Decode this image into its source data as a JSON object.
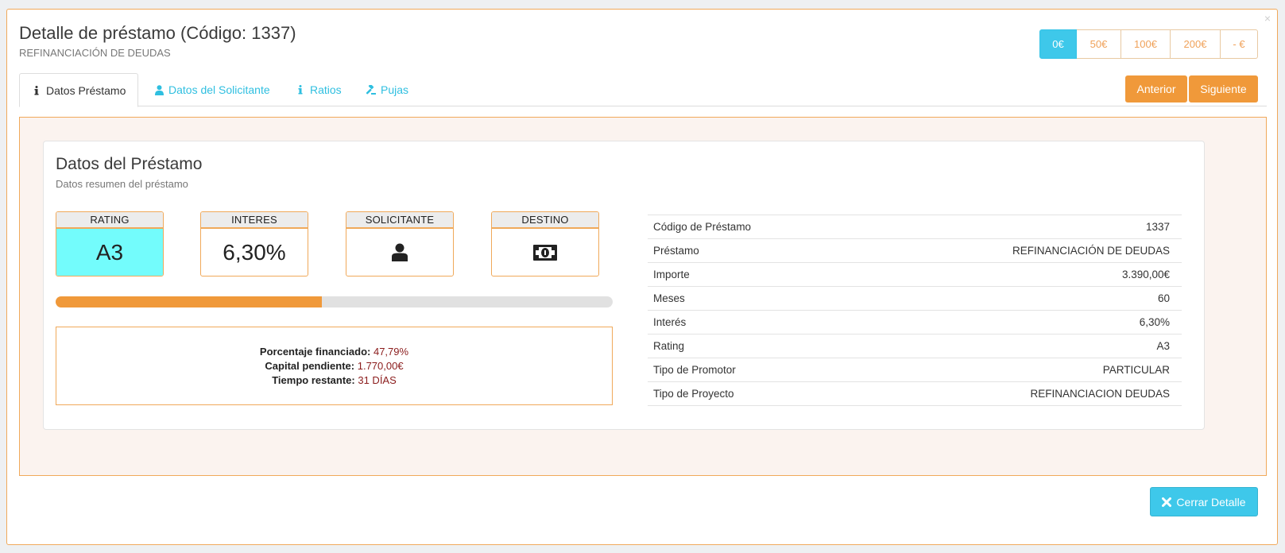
{
  "modal": {
    "title": "Detalle de préstamo (Código: 1337)",
    "subtitle": "REFINANCIACIÓN DE DEUDAS",
    "close_glyph": "×"
  },
  "amount_buttons": [
    {
      "label": "0€",
      "active": true
    },
    {
      "label": "50€",
      "active": false
    },
    {
      "label": "100€",
      "active": false
    },
    {
      "label": "200€",
      "active": false
    },
    {
      "label": "- €",
      "active": false
    }
  ],
  "tabs": [
    {
      "label": "Datos Préstamo",
      "icon": "info-icon",
      "active": true
    },
    {
      "label": "Datos del Solicitante",
      "icon": "user-icon",
      "active": false
    },
    {
      "label": "Ratios",
      "icon": "info-icon",
      "active": false
    },
    {
      "label": "Pujas",
      "icon": "gavel-icon",
      "active": false
    }
  ],
  "nav": {
    "prev": "Anterior",
    "next": "Siguiente"
  },
  "card": {
    "title": "Datos del Préstamo",
    "subtitle": "Datos resumen del préstamo",
    "boxes": [
      {
        "header": "RATING",
        "value": "A3"
      },
      {
        "header": "INTERES",
        "value": "6,30%"
      },
      {
        "header": "SOLICITANTE",
        "icon": "user-icon"
      },
      {
        "header": "DESTINO",
        "icon": "money-icon"
      }
    ],
    "progress_percent": 47.79,
    "stats": [
      {
        "label": "Porcentaje financiado:",
        "value": "47,79%"
      },
      {
        "label": "Capital pendiente:",
        "value": "1.770,00€"
      },
      {
        "label": "Tiempo restante:",
        "value": "31 DÍAS"
      }
    ],
    "details": [
      {
        "label": "Código de Préstamo",
        "value": "1337"
      },
      {
        "label": "Préstamo",
        "value": "REFINANCIACIÓN DE DEUDAS"
      },
      {
        "label": "Importe",
        "value": "3.390,00€"
      },
      {
        "label": "Meses",
        "value": "60"
      },
      {
        "label": "Interés",
        "value": "6,30%"
      },
      {
        "label": "Rating",
        "value": "A3"
      },
      {
        "label": "Tipo de Promotor",
        "value": "PARTICULAR"
      },
      {
        "label": "Tipo de Proyecto",
        "value": "REFINANCIACION DEUDAS"
      }
    ]
  },
  "close_button": {
    "label": "Cerrar Detalle",
    "icon": "close-icon"
  },
  "colors": {
    "accent_orange": "#f0993a",
    "accent_cyan": "#3ec8ea",
    "rating_bg": "#73fcfc",
    "stat_value": "#8b1c1c"
  }
}
